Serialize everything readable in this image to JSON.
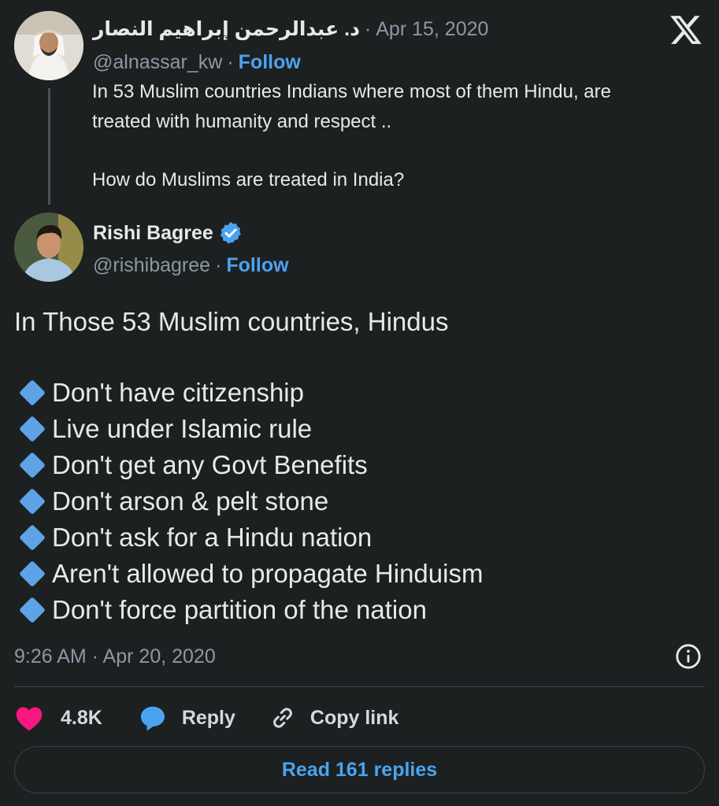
{
  "parent_tweet": {
    "author_name": "د. عبدالرحمن إبراهيم النصار",
    "date": "Apr 15, 2020",
    "handle": "@alnassar_kw",
    "follow_label": "Follow",
    "text_line_1": "In 53 Muslim countries Indians where most of them Hindu, are",
    "text_line_2": "treated with humanity and respect ..",
    "text_line_3": "How do Muslims are treated in India?"
  },
  "reply_tweet": {
    "author_name": "Rishi Bagree",
    "handle": "@rishibagree",
    "follow_label": "Follow",
    "intro": "In Those 53 Muslim countries, Hindus",
    "points": [
      "Don't have citizenship",
      "Live under Islamic rule",
      "Don't get any Govt Benefits",
      "Don't arson & pelt stone",
      "Don't ask for a Hindu nation",
      "Aren't allowed to propagate Hinduism",
      "Don't force partition of the nation"
    ],
    "timestamp": "9:26 AM · Apr 20, 2020"
  },
  "actions": {
    "likes": "4.8K",
    "reply_label": "Reply",
    "copy_label": "Copy link"
  },
  "read_replies_label": "Read 161 replies",
  "separator": "·",
  "colors": {
    "background": "#1c2020",
    "accent": "#4ba3f0",
    "like": "#f91880",
    "bullet_diamond": "#5ea3e6"
  },
  "icons": [
    "x-logo-icon",
    "verified-badge-icon",
    "info-icon",
    "heart-icon",
    "reply-bubble-icon",
    "link-icon",
    "diamond-bullet-icon"
  ]
}
